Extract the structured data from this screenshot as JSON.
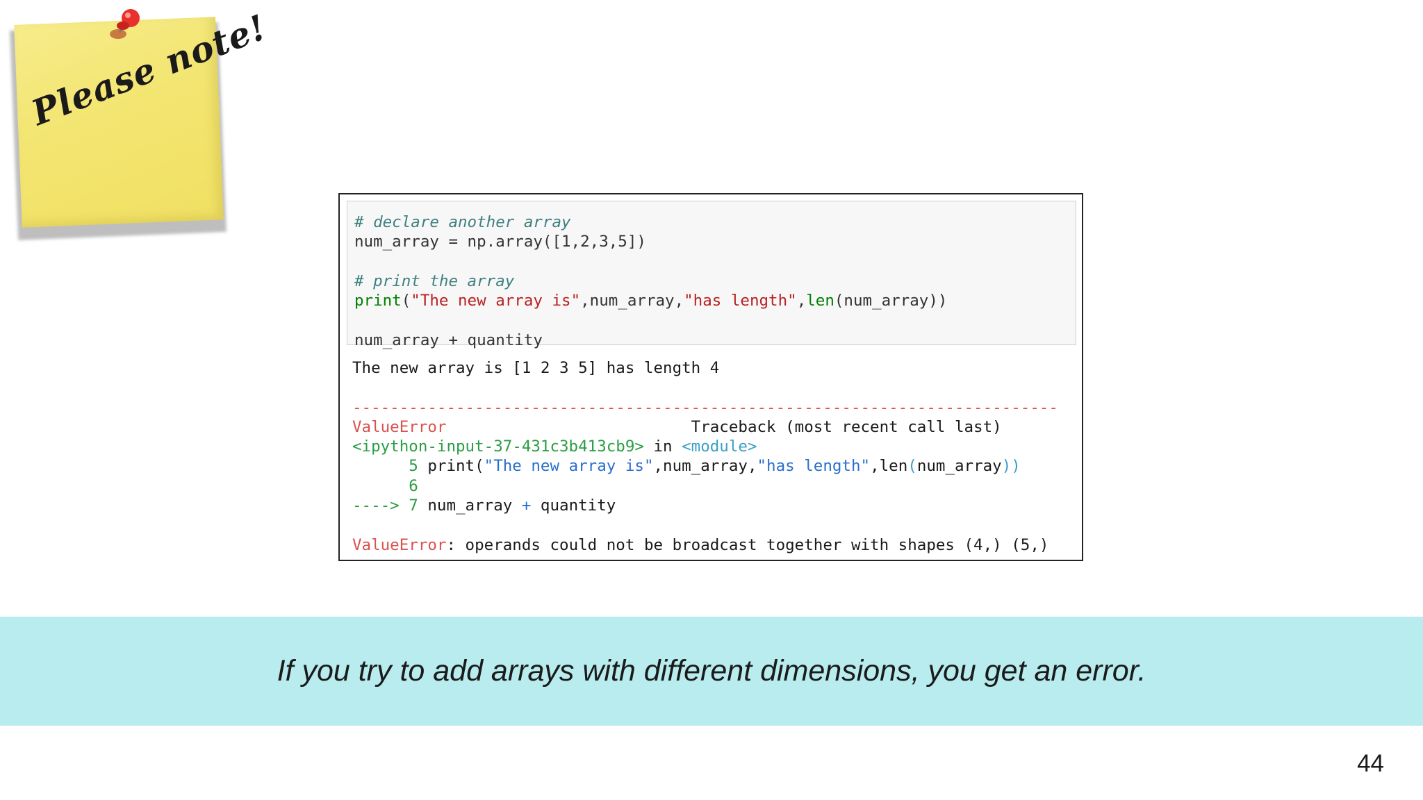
{
  "note": {
    "text": "Please note!",
    "colors": {
      "paper": "#f3e571",
      "pin": "#e8312c"
    },
    "icon": "pushpin-icon"
  },
  "code_cell": {
    "input_lines": [
      "# declare another array",
      "num_array = np.array([1,2,3,5])",
      "",
      "# print the array",
      "print(\"The new array is\",num_array,\"has length\",len(num_array))",
      "",
      "num_array + quantity"
    ],
    "output": {
      "printed": "The new array is [1 2 3 5] has length 4",
      "separator": "---------------------------------------------------------------------------",
      "error_name": "ValueError",
      "traceback_header": "Traceback (most recent call last)",
      "input_ref": "<ipython-input-37-431c3b413cb9>",
      "in_word": "in",
      "module_ref": "<module>",
      "tb_lines": [
        {
          "arrow": "     ",
          "num": "5",
          "code_pre": " print(",
          "str1": "\"The new array is\"",
          "mid1": ",num_array,",
          "str2": "\"has length\"",
          "mid2": ",len",
          "paren": "(",
          "arg": "num_array",
          "close": "))"
        },
        {
          "arrow": "     ",
          "num": "6"
        },
        {
          "arrow": "---->",
          "num": " 7",
          "code": " num_array ",
          "op": "+",
          "rest": " quantity"
        }
      ],
      "final_error_name": "ValueError",
      "final_error_msg": ": operands could not be broadcast together with shapes (4,) (5,)"
    }
  },
  "banner": {
    "text": "If you try to add arrays with different dimensions, you get an error.",
    "color": "#b8ecef"
  },
  "page_number": "44"
}
